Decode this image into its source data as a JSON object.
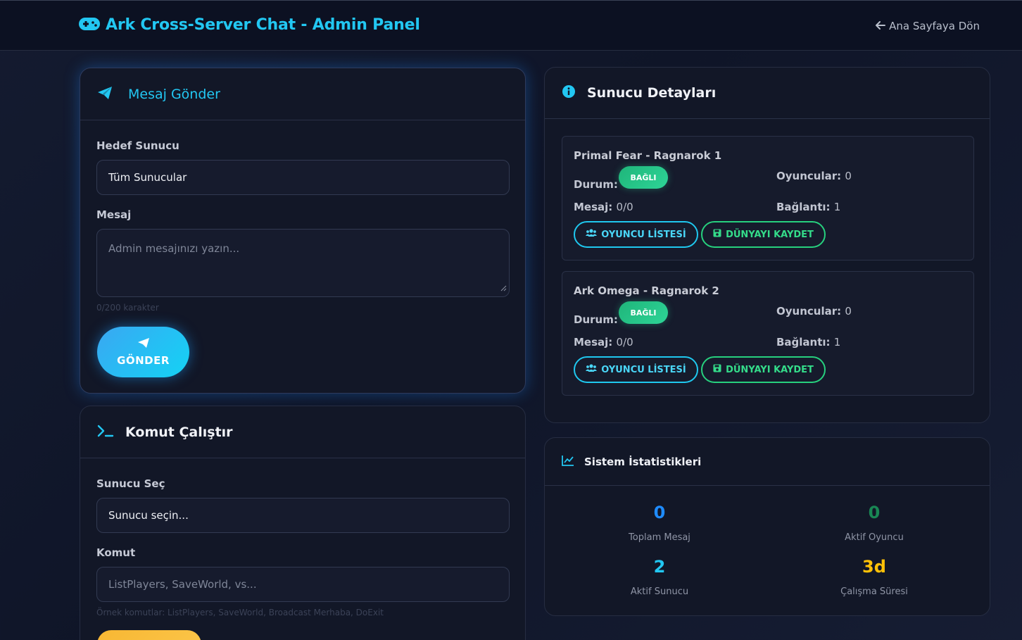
{
  "navbar": {
    "title": "Ark Cross-Server Chat - Admin Panel",
    "back_label": "Ana Sayfaya Dön",
    "accent_color": "#22c7f2"
  },
  "send_message": {
    "title": "Mesaj Gönder",
    "target_label": "Hedef Sunucu",
    "target_value": "Tüm Sunucular",
    "message_label": "Mesaj",
    "message_placeholder": "Admin mesajınızı yazın...",
    "char_counter": "0/200 karakter",
    "send_button": "GÖNDER"
  },
  "run_command": {
    "title": "Komut Çalıştır",
    "server_label": "Sunucu Seç",
    "server_value": "Sunucu seçin...",
    "command_label": "Komut",
    "command_placeholder": "ListPlayers, SaveWorld, vs...",
    "examples_hint": "Örnek komutlar: ListPlayers, SaveWorld, Broadcast Merhaba, DoExit"
  },
  "server_details": {
    "title": "Sunucu Detayları",
    "status_key": "Durum:",
    "players_key": "Oyuncular:",
    "messages_key": "Mesaj:",
    "connections_key": "Bağlantı:",
    "servers": [
      {
        "name": "Primal Fear - Ragnarok 1",
        "status": "BAĞLI",
        "players": "0",
        "messages": "0/0",
        "connections": "1",
        "player_list_button": "OYUNCU LİSTESİ",
        "save_world_button": "DÜNYAYI KAYDET"
      },
      {
        "name": "Ark Omega - Ragnarok 2",
        "status": "BAĞLI",
        "players": "0",
        "messages": "0/0",
        "connections": "1",
        "player_list_button": "OYUNCU LİSTESİ",
        "save_world_button": "DÜNYAYI KAYDET"
      }
    ]
  },
  "system_stats": {
    "title": "Sistem İstatistikleri",
    "stats": [
      {
        "value": "0",
        "label": "Toplam Mesaj",
        "color": "#1f8cff"
      },
      {
        "value": "0",
        "label": "Aktif Oyuncu",
        "color": "#198754"
      },
      {
        "value": "2",
        "label": "Aktif Sunucu",
        "color": "#22c7f2"
      },
      {
        "value": "3d",
        "label": "Çalışma Süresi",
        "color": "#ffc107"
      }
    ]
  }
}
